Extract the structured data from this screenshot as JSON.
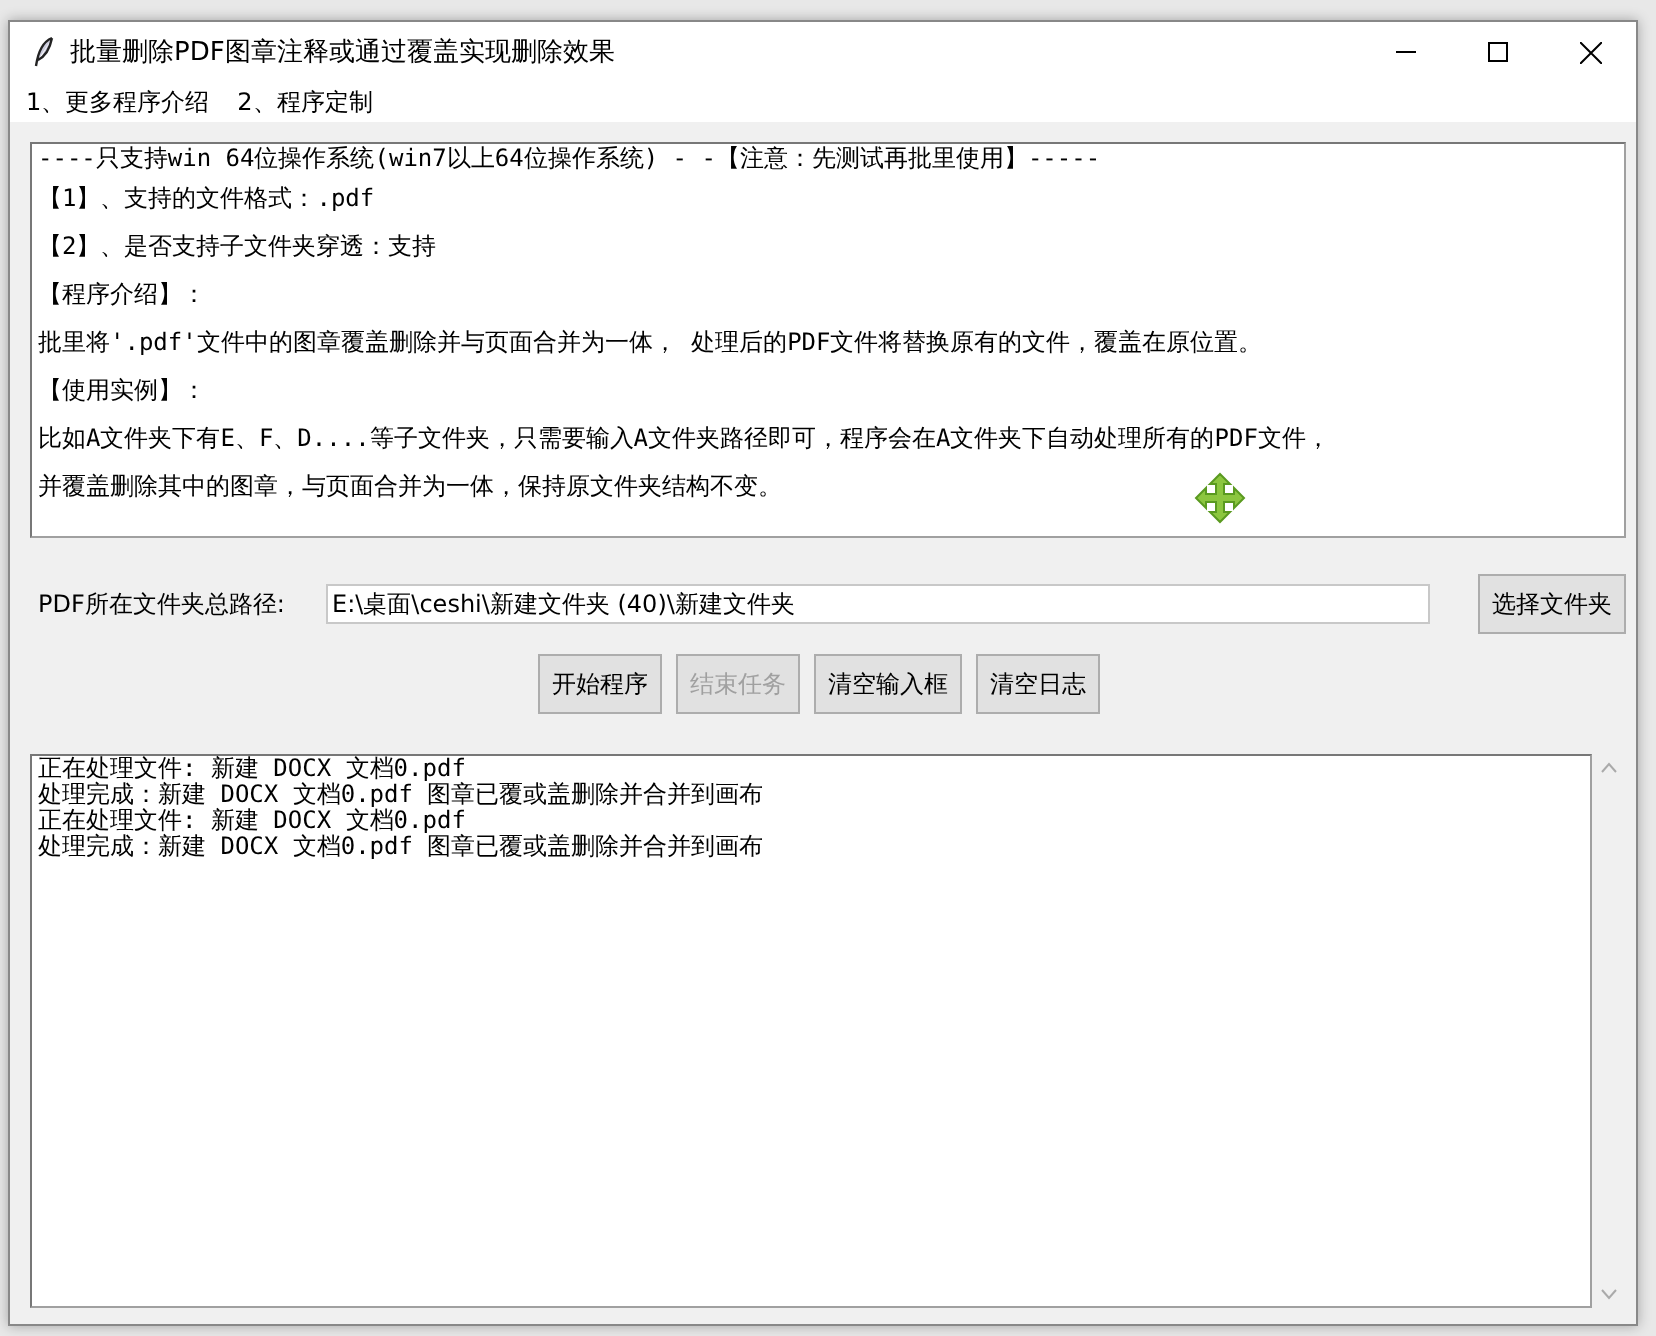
{
  "window": {
    "title": "批量删除PDF图章注释或通过覆盖实现删除效果"
  },
  "menu": [
    "1、更多程序介绍",
    "2、程序定制"
  ],
  "intro_lines": [
    "----只支持win 64位操作系统(win7以上64位操作系统) - -【注意：先测试再批里使用】-----",
    "【1】、支持的文件格式：.pdf",
    "【2】、是否支持子文件夹穿透：支持",
    "【程序介绍】：",
    "批里将'.pdf'文件中的图章覆盖删除并与页面合并为一体， 处理后的PDF文件将替换原有的文件，覆盖在原位置。",
    "【使用实例】：",
    "比如A文件夹下有E、F、D....等子文件夹，只需要输入A文件夹路径即可，程序会在A文件夹下自动处理所有的PDF文件，",
    "并覆盖删除其中的图章，与页面合并为一体，保持原文件夹结构不变。"
  ],
  "path": {
    "label": "PDF所在文件夹总路径:",
    "value": "E:\\桌面\\ceshi\\新建文件夹 (40)\\新建文件夹",
    "button": "选择文件夹"
  },
  "actions": [
    {
      "label": "开始程序",
      "disabled": false
    },
    {
      "label": "结束任务",
      "disabled": true
    },
    {
      "label": "清空输入框",
      "disabled": false
    },
    {
      "label": "清空日志",
      "disabled": false
    }
  ],
  "log_lines": [
    "正在处理文件: 新建 DOCX 文档0.pdf",
    "处理完成：新建 DOCX 文档0.pdf 图章已覆或盖删除并合并到画布",
    "正在处理文件: 新建 DOCX 文档0.pdf",
    "处理完成：新建 DOCX 文档0.pdf 图章已覆或盖删除并合并到画布"
  ]
}
